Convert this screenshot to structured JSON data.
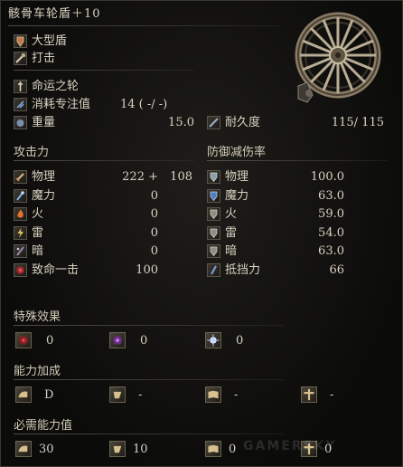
{
  "title": "骸骨车轮盾＋10",
  "weapon_type": "大型盾",
  "attack_type": "打击",
  "skill": "命运之轮",
  "fp_label": "消耗专注值",
  "fp_value": "14 (  -/  -)",
  "weight_label": "重量",
  "weight_value": "15.0",
  "durability_label": "耐久度",
  "durability_value": "115/  115",
  "attack": {
    "header": "攻击力",
    "rows": [
      {
        "label": "物理",
        "value": "222 +",
        "extra": "108",
        "icon": "sword-icon"
      },
      {
        "label": "魔力",
        "value": "0",
        "icon": "magic-icon"
      },
      {
        "label": "火",
        "value": "0",
        "icon": "fire-icon"
      },
      {
        "label": "雷",
        "value": "0",
        "icon": "lightning-icon"
      },
      {
        "label": "暗",
        "value": "0",
        "icon": "dark-icon"
      },
      {
        "label": "致命一击",
        "value": "100",
        "icon": "critical-icon"
      }
    ]
  },
  "defense": {
    "header": "防御减伤率",
    "rows": [
      {
        "label": "物理",
        "value": "100.0",
        "icon": "shield-physical-icon"
      },
      {
        "label": "魔力",
        "value": "63.0",
        "icon": "shield-magic-icon"
      },
      {
        "label": "火",
        "value": "59.0",
        "icon": "shield-fire-icon"
      },
      {
        "label": "雷",
        "value": "54.0",
        "icon": "shield-lightning-icon"
      },
      {
        "label": "暗",
        "value": "63.0",
        "icon": "shield-dark-icon"
      },
      {
        "label": "抵挡力",
        "value": "66",
        "icon": "stability-icon"
      }
    ]
  },
  "special": {
    "header": "特殊效果",
    "items": [
      {
        "value": "0",
        "icon": "bleed-icon"
      },
      {
        "value": "0",
        "icon": "poison-icon"
      },
      {
        "value": "0",
        "icon": "frost-icon"
      }
    ]
  },
  "scaling": {
    "header": "能力加成",
    "items": [
      {
        "value": "D",
        "icon": "strength-icon"
      },
      {
        "value": "-",
        "icon": "dexterity-icon"
      },
      {
        "value": "-",
        "icon": "intelligence-icon"
      },
      {
        "value": "-",
        "icon": "faith-icon"
      }
    ]
  },
  "requirements": {
    "header": "必需能力值",
    "items": [
      {
        "value": "30",
        "icon": "strength-icon"
      },
      {
        "value": "10",
        "icon": "dexterity-icon"
      },
      {
        "value": "0",
        "icon": "intelligence-icon"
      },
      {
        "value": "0",
        "icon": "faith-icon"
      }
    ]
  },
  "watermark": "GAMERSKY"
}
